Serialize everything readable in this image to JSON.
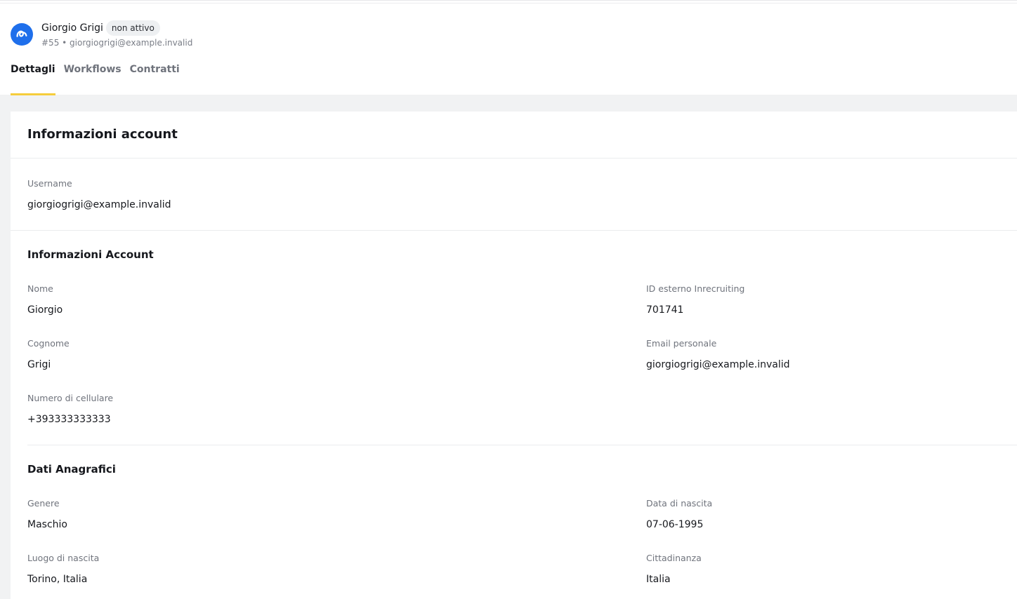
{
  "header": {
    "user_name": "Giorgio Grigi",
    "status": "non attivo",
    "subtitle": "#55 • giorgiogrigi@example.invalid",
    "avatar_icon": "brand-logo-icon",
    "tabs": [
      {
        "label": "Dettagli",
        "active": true
      },
      {
        "label": "Workflows",
        "active": false
      },
      {
        "label": "Contratti",
        "active": false
      }
    ]
  },
  "card": {
    "title": "Informazioni account",
    "username": {
      "label": "Username",
      "value": "giorgiogrigi@example.invalid"
    },
    "account_section": {
      "title": "Informazioni Account",
      "nome": {
        "label": "Nome",
        "value": "Giorgio"
      },
      "id_esterno": {
        "label": "ID esterno Inrecruiting",
        "value": "701741"
      },
      "cognome": {
        "label": "Cognome",
        "value": "Grigi"
      },
      "email_personale": {
        "label": "Email personale",
        "value": "giorgiogrigi@example.invalid"
      },
      "cellulare": {
        "label": "Numero di cellulare",
        "value": "+393333333333"
      }
    },
    "anagrafici_section": {
      "title": "Dati Anagrafici",
      "genere": {
        "label": "Genere",
        "value": "Maschio"
      },
      "data_nascita": {
        "label": "Data di nascita",
        "value": "07-06-1995"
      },
      "luogo_nascita": {
        "label": "Luogo di nascita",
        "value": "Torino, Italia"
      },
      "cittadinanza": {
        "label": "Cittadinanza",
        "value": "Italia"
      }
    }
  },
  "colors": {
    "accent_tab": "#f5cd3c",
    "avatar_bg": "#1f6feb",
    "page_bg": "#f1f2f3"
  }
}
